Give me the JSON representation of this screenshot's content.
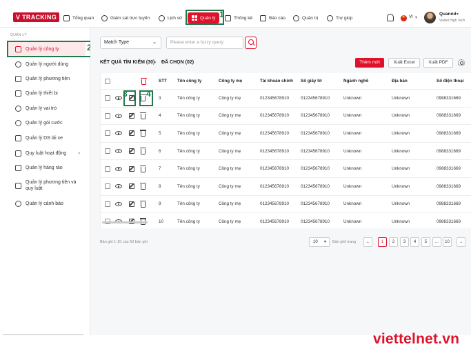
{
  "header": {
    "logo": "V TRACKING",
    "nav": [
      {
        "label": "Tổng quan",
        "icon": "home-icon"
      },
      {
        "label": "Giám sát trực tuyến",
        "icon": "target-icon"
      },
      {
        "label": "Lịch sử",
        "icon": "history-icon"
      },
      {
        "label": "Quản lý",
        "icon": "grid-icon",
        "active": true
      },
      {
        "label": "Thống kê",
        "icon": "chart-icon"
      },
      {
        "label": "Báo cáo",
        "icon": "clipboard-icon"
      },
      {
        "label": "Quản trị",
        "icon": "gear-icon"
      },
      {
        "label": "Trợ giúp",
        "icon": "help-icon"
      }
    ],
    "language": "VI",
    "user_name": "Quannd",
    "user_org": "Viettel High Tech"
  },
  "annotations": [
    "1",
    "2",
    "3",
    "4"
  ],
  "sidebar": {
    "section": "QUẢN LÝ",
    "items": [
      {
        "label": "Quản lý công ty",
        "icon": "building-icon",
        "active": true
      },
      {
        "label": "Quản lý người dùng",
        "icon": "users-icon"
      },
      {
        "label": "Quản lý phương tiện",
        "icon": "truck-icon"
      },
      {
        "label": "Quản lý thiết bị",
        "icon": "device-icon"
      },
      {
        "label": "Quản lý vai trò",
        "icon": "user-role-icon"
      },
      {
        "label": "Quản lý gói cước",
        "icon": "dollar-icon"
      },
      {
        "label": "Quản lý DS lái xe",
        "icon": "id-card-icon"
      },
      {
        "label": "Quy luật hoạt động",
        "icon": "rule-icon",
        "has_submenu": true
      },
      {
        "label": "Quản lý hàng rào",
        "icon": "fence-icon"
      },
      {
        "label": "Quản lý phương tiện và quy luật",
        "icon": "vehicle-rule-icon"
      },
      {
        "label": "Quản lý cảnh báo",
        "icon": "alert-icon"
      }
    ]
  },
  "toolbar": {
    "match_type": "Match Type",
    "search_placeholder": "Please enter a fuzzy query",
    "result_title": "KẾT QUẢ TÌM KIẾM (30)",
    "separator": "-",
    "selected": "ĐÃ CHỌN (02)",
    "add_label": "Thêm mới",
    "export_excel": "Xuất Excel",
    "export_pdf": "Xuất PDF"
  },
  "table": {
    "columns": [
      "STT",
      "Tên công ty",
      "Công ty mẹ",
      "Tài khoản chính",
      "Số giấy tờ",
      "Ngành nghề",
      "Địa bàn",
      "Số điện thoại"
    ],
    "rows": [
      [
        "3",
        "Tên công ty",
        "Công ty mẹ",
        "012345678910",
        "012345678910",
        "Unknown",
        "Unknown",
        "0988331669"
      ],
      [
        "4",
        "Tên công ty",
        "Công ty mẹ",
        "012345678910",
        "012345678910",
        "Unknown",
        "Unknown",
        "0988331669"
      ],
      [
        "5",
        "Tên công ty",
        "Công ty mẹ",
        "012345678910",
        "012345678910",
        "Unknown",
        "Unknown",
        "0988331669"
      ],
      [
        "6",
        "Tên công ty",
        "Công ty mẹ",
        "012345678910",
        "012345678910",
        "Unknown",
        "Unknown",
        "0988331669"
      ],
      [
        "7",
        "Tên công ty",
        "Công ty mẹ",
        "012345678910",
        "012345678910",
        "Unknown",
        "Unknown",
        "0988331669"
      ],
      [
        "8",
        "Tên công ty",
        "Công ty mẹ",
        "012345678910",
        "012345678910",
        "Unknown",
        "Unknown",
        "0988331669"
      ],
      [
        "9",
        "Tên công ty",
        "Công ty mẹ",
        "012345678910",
        "012345678910",
        "Unknown",
        "Unknown",
        "0988331669"
      ],
      [
        "10",
        "Tên công ty",
        "Công ty mẹ",
        "012345678910",
        "012345678910",
        "Unknown",
        "Unknown",
        "0988331669"
      ]
    ]
  },
  "footer": {
    "info": "Bản ghi 1-10 của 50 bản ghi",
    "per_page": "10",
    "per_page_label": "Bản ghi/ trang",
    "pages": [
      "1",
      "2",
      "3",
      "4",
      "5",
      "...",
      "10"
    ],
    "current_page": "1"
  },
  "watermark": "viettelnet.vn",
  "colors": {
    "accent": "#e0112b",
    "highlight": "#1f7a4d"
  }
}
